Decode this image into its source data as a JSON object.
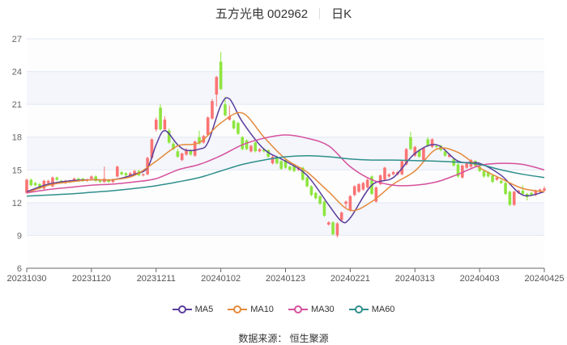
{
  "header": {
    "stock_name": "五方光电 002962",
    "period": "日K"
  },
  "source": "数据来源：  恒生聚源",
  "colors": {
    "up": "#fb7474",
    "down": "#8ee53f",
    "MA5": "#5a3d9c",
    "MA10": "#e48a3a",
    "MA30": "#d6509c",
    "MA60": "#2f8f8c"
  },
  "chart_data": {
    "type": "candlestick",
    "title": "五方光电 002962 日K",
    "ylim": [
      6,
      27
    ],
    "yticks": [
      "6",
      "9",
      "12",
      "15",
      "18",
      "21",
      "24",
      "27"
    ],
    "xticks": [
      {
        "day": 0,
        "label": "20231030"
      },
      {
        "day": 15,
        "label": "20231120"
      },
      {
        "day": 30,
        "label": "20231211"
      },
      {
        "day": 45,
        "label": "20240102"
      },
      {
        "day": 60,
        "label": "20240123"
      },
      {
        "day": 75,
        "label": "20240221"
      },
      {
        "day": 90,
        "label": "20240313"
      },
      {
        "day": 105,
        "label": "20240403"
      },
      {
        "day": 120,
        "label": "20240425"
      }
    ],
    "num_days": 121,
    "candles_ohlc": [
      [
        12.9,
        14.1,
        12.8,
        14.2
      ],
      [
        14.1,
        13.6,
        13.5,
        14.2
      ],
      [
        13.8,
        13.6,
        13.5,
        13.9
      ],
      [
        13.7,
        13.3,
        13.2,
        13.8
      ],
      [
        13.3,
        14.0,
        13.2,
        14.1
      ],
      [
        13.8,
        14.0,
        13.7,
        14.1
      ],
      [
        13.5,
        14.3,
        13.4,
        14.4
      ],
      [
        14.3,
        14.1,
        14.0,
        14.4
      ],
      [
        14.0,
        13.9,
        13.8,
        14.1
      ],
      [
        13.8,
        14.0,
        13.7,
        14.1
      ],
      [
        13.9,
        14.0,
        13.8,
        14.1
      ],
      [
        14.0,
        14.2,
        13.9,
        14.3
      ],
      [
        14.2,
        14.0,
        13.9,
        14.3
      ],
      [
        14.2,
        14.0,
        13.9,
        14.3
      ],
      [
        14.0,
        14.1,
        13.9,
        14.2
      ],
      [
        14.2,
        14.4,
        14.1,
        14.5
      ],
      [
        14.4,
        14.0,
        13.9,
        14.5
      ],
      [
        14.0,
        13.9,
        13.8,
        14.1
      ],
      [
        13.9,
        14.2,
        13.8,
        15.3
      ],
      [
        14.1,
        13.9,
        13.8,
        14.2
      ],
      [
        13.9,
        14.1,
        13.8,
        14.2
      ],
      [
        14.4,
        15.3,
        14.3,
        15.4
      ],
      [
        14.8,
        14.6,
        14.5,
        14.9
      ],
      [
        14.7,
        14.5,
        14.4,
        14.8
      ],
      [
        14.5,
        14.7,
        14.4,
        14.8
      ],
      [
        14.6,
        14.9,
        14.5,
        15.0
      ],
      [
        14.9,
        14.5,
        14.4,
        15.0
      ],
      [
        14.5,
        14.6,
        14.4,
        14.7
      ],
      [
        14.6,
        16.1,
        14.5,
        16.2
      ],
      [
        16.1,
        17.8,
        16.0,
        17.9
      ],
      [
        18.7,
        19.6,
        18.5,
        19.8
      ],
      [
        20.7,
        18.7,
        18.6,
        21.0
      ],
      [
        18.7,
        19.6,
        18.6,
        19.9
      ],
      [
        18.6,
        17.5,
        17.4,
        18.8
      ],
      [
        17.4,
        16.9,
        16.8,
        17.6
      ],
      [
        16.7,
        16.2,
        16.1,
        16.9
      ],
      [
        15.9,
        16.5,
        15.8,
        16.6
      ],
      [
        16.4,
        16.8,
        16.3,
        17.0
      ],
      [
        16.8,
        16.4,
        16.3,
        16.9
      ],
      [
        16.3,
        17.6,
        16.2,
        17.7
      ],
      [
        18.0,
        17.4,
        17.3,
        18.6
      ],
      [
        17.5,
        18.1,
        17.4,
        18.2
      ],
      [
        18.2,
        19.8,
        18.1,
        19.9
      ],
      [
        19.7,
        21.3,
        19.6,
        21.5
      ],
      [
        21.9,
        23.5,
        20.8,
        23.6
      ],
      [
        24.9,
        22.4,
        22.3,
        25.8
      ],
      [
        21.0,
        20.0,
        19.9,
        21.7
      ],
      [
        19.6,
        19.9,
        19.5,
        20.9
      ],
      [
        19.5,
        18.8,
        18.7,
        19.6
      ],
      [
        19.3,
        18.3,
        18.2,
        19.4
      ],
      [
        18.0,
        16.9,
        16.8,
        18.1
      ],
      [
        17.7,
        16.9,
        16.8,
        17.8
      ],
      [
        16.7,
        17.2,
        16.6,
        17.3
      ],
      [
        17.5,
        16.7,
        16.6,
        17.6
      ],
      [
        16.7,
        16.9,
        16.6,
        17.0
      ],
      [
        16.9,
        16.7,
        16.6,
        17.0
      ],
      [
        16.8,
        16.2,
        16.1,
        16.9
      ],
      [
        15.6,
        16.2,
        15.5,
        16.3
      ],
      [
        16.2,
        15.6,
        15.5,
        16.3
      ],
      [
        15.8,
        15.1,
        15.0,
        15.9
      ],
      [
        15.9,
        15.2,
        15.1,
        16.0
      ],
      [
        15.3,
        15.0,
        14.9,
        15.4
      ],
      [
        15.4,
        14.9,
        14.8,
        15.5
      ],
      [
        15.0,
        15.2,
        14.9,
        15.3
      ],
      [
        15.2,
        14.1,
        14.0,
        15.3
      ],
      [
        14.3,
        13.5,
        13.4,
        14.4
      ],
      [
        13.5,
        12.7,
        12.6,
        13.6
      ],
      [
        12.9,
        12.4,
        12.3,
        13.0
      ],
      [
        12.6,
        11.9,
        11.8,
        12.7
      ],
      [
        12.1,
        10.8,
        10.7,
        12.2
      ],
      [
        10.0,
        10.2,
        9.9,
        10.3
      ],
      [
        10.2,
        9.1,
        9.0,
        10.3
      ],
      [
        9.0,
        10.1,
        8.8,
        10.2
      ],
      [
        10.4,
        11.1,
        10.3,
        11.2
      ],
      [
        11.9,
        12.1,
        11.5,
        12.2
      ],
      [
        11.3,
        12.6,
        11.2,
        12.7
      ],
      [
        12.7,
        13.5,
        12.6,
        13.6
      ],
      [
        13.0,
        13.7,
        12.9,
        13.8
      ],
      [
        13.2,
        13.8,
        13.1,
        13.9
      ],
      [
        13.4,
        14.1,
        13.3,
        14.2
      ],
      [
        14.4,
        12.8,
        12.7,
        14.5
      ],
      [
        12.1,
        13.4,
        12.0,
        13.5
      ],
      [
        13.7,
        14.5,
        13.6,
        14.6
      ],
      [
        14.1,
        15.2,
        14.0,
        15.3
      ],
      [
        14.4,
        14.6,
        14.3,
        14.7
      ],
      [
        14.6,
        14.8,
        14.5,
        14.9
      ],
      [
        14.6,
        14.8,
        14.5,
        14.9
      ],
      [
        14.6,
        15.8,
        14.5,
        15.9
      ],
      [
        15.5,
        16.9,
        15.4,
        17.0
      ],
      [
        18.0,
        16.9,
        16.8,
        18.5
      ],
      [
        16.3,
        17.1,
        16.2,
        17.2
      ],
      [
        16.8,
        16.2,
        16.1,
        16.9
      ],
      [
        15.9,
        17.0,
        15.8,
        17.1
      ],
      [
        17.8,
        17.2,
        17.1,
        18.0
      ],
      [
        17.1,
        17.8,
        17.0,
        17.9
      ],
      [
        17.2,
        17.1,
        17.0,
        17.3
      ],
      [
        17.2,
        16.8,
        16.7,
        17.3
      ],
      [
        16.7,
        16.3,
        16.2,
        16.8
      ],
      [
        16.2,
        16.4,
        16.1,
        16.5
      ],
      [
        16.0,
        15.4,
        15.3,
        16.1
      ],
      [
        15.5,
        14.4,
        14.3,
        15.6
      ],
      [
        14.3,
        15.4,
        14.2,
        15.5
      ],
      [
        15.2,
        15.6,
        15.1,
        15.7
      ],
      [
        15.3,
        15.9,
        15.2,
        16.0
      ],
      [
        15.8,
        15.4,
        15.3,
        15.9
      ],
      [
        15.3,
        14.9,
        14.8,
        15.4
      ],
      [
        14.9,
        14.4,
        14.3,
        15.0
      ],
      [
        14.8,
        14.4,
        14.3,
        14.9
      ],
      [
        14.5,
        13.9,
        13.8,
        14.6
      ],
      [
        14.1,
        14.3,
        14.0,
        14.4
      ],
      [
        14.0,
        13.8,
        13.7,
        14.1
      ],
      [
        13.8,
        12.8,
        12.7,
        13.9
      ],
      [
        13.0,
        11.8,
        11.7,
        13.1
      ],
      [
        11.8,
        13.0,
        11.7,
        13.1
      ],
      [
        12.9,
        13.1,
        12.8,
        13.2
      ],
      [
        13.1,
        12.8,
        12.7,
        13.6
      ],
      [
        12.8,
        12.5,
        12.2,
        12.9
      ],
      [
        12.9,
        12.7,
        12.6,
        13.0
      ],
      [
        12.7,
        13.1,
        12.6,
        13.2
      ],
      [
        13.0,
        13.2,
        12.9,
        13.3
      ],
      [
        13.1,
        13.3,
        13.0,
        13.5
      ]
    ],
    "series": [
      {
        "name": "MA5",
        "points": [
          [
            0,
            13.0
          ],
          [
            5,
            13.7
          ],
          [
            10,
            14.0
          ],
          [
            15,
            14.1
          ],
          [
            20,
            14.1
          ],
          [
            25,
            14.6
          ],
          [
            28,
            15.2
          ],
          [
            30,
            17.3
          ],
          [
            32,
            18.6
          ],
          [
            35,
            17.3
          ],
          [
            37,
            16.8
          ],
          [
            40,
            16.9
          ],
          [
            42,
            17.5
          ],
          [
            45,
            20.9
          ],
          [
            47,
            21.5
          ],
          [
            50,
            19.4
          ],
          [
            55,
            16.9
          ],
          [
            60,
            15.8
          ],
          [
            65,
            14.5
          ],
          [
            70,
            11.8
          ],
          [
            73,
            10.3
          ],
          [
            75,
            10.6
          ],
          [
            80,
            13.6
          ],
          [
            85,
            14.3
          ],
          [
            90,
            16.5
          ],
          [
            95,
            17.3
          ],
          [
            100,
            15.8
          ],
          [
            105,
            15.6
          ],
          [
            110,
            14.5
          ],
          [
            115,
            12.7
          ],
          [
            120,
            13.0
          ]
        ]
      },
      {
        "name": "MA10",
        "points": [
          [
            0,
            12.9
          ],
          [
            5,
            13.6
          ],
          [
            10,
            13.9
          ],
          [
            15,
            14.1
          ],
          [
            20,
            14.1
          ],
          [
            25,
            14.5
          ],
          [
            30,
            15.8
          ],
          [
            35,
            17.2
          ],
          [
            40,
            17.5
          ],
          [
            45,
            19.3
          ],
          [
            50,
            20.2
          ],
          [
            55,
            18.0
          ],
          [
            60,
            16.0
          ],
          [
            65,
            14.8
          ],
          [
            70,
            13.0
          ],
          [
            75,
            11.3
          ],
          [
            80,
            12.1
          ],
          [
            85,
            13.7
          ],
          [
            90,
            14.9
          ],
          [
            95,
            16.9
          ],
          [
            100,
            16.6
          ],
          [
            105,
            15.2
          ],
          [
            110,
            14.2
          ],
          [
            115,
            13.3
          ],
          [
            120,
            13.0
          ]
        ]
      },
      {
        "name": "MA30",
        "points": [
          [
            0,
            12.9
          ],
          [
            5,
            13.2
          ],
          [
            10,
            13.4
          ],
          [
            15,
            13.6
          ],
          [
            20,
            13.7
          ],
          [
            25,
            13.9
          ],
          [
            30,
            14.2
          ],
          [
            35,
            15.0
          ],
          [
            40,
            15.5
          ],
          [
            45,
            16.3
          ],
          [
            50,
            17.3
          ],
          [
            55,
            17.9
          ],
          [
            60,
            18.2
          ],
          [
            65,
            17.9
          ],
          [
            70,
            17.2
          ],
          [
            75,
            15.3
          ],
          [
            80,
            14.1
          ],
          [
            85,
            13.6
          ],
          [
            90,
            13.6
          ],
          [
            95,
            13.9
          ],
          [
            100,
            14.6
          ],
          [
            105,
            15.4
          ],
          [
            110,
            15.6
          ],
          [
            115,
            15.5
          ],
          [
            120,
            15.0
          ]
        ]
      },
      {
        "name": "MA60",
        "points": [
          [
            0,
            12.6
          ],
          [
            5,
            12.7
          ],
          [
            10,
            12.8
          ],
          [
            15,
            12.95
          ],
          [
            20,
            13.1
          ],
          [
            25,
            13.3
          ],
          [
            30,
            13.55
          ],
          [
            35,
            13.9
          ],
          [
            40,
            14.3
          ],
          [
            45,
            14.9
          ],
          [
            50,
            15.5
          ],
          [
            55,
            15.9
          ],
          [
            60,
            16.2
          ],
          [
            65,
            16.3
          ],
          [
            70,
            16.2
          ],
          [
            75,
            16.0
          ],
          [
            80,
            15.9
          ],
          [
            85,
            15.9
          ],
          [
            90,
            15.85
          ],
          [
            95,
            15.8
          ],
          [
            100,
            15.7
          ],
          [
            105,
            15.5
          ],
          [
            110,
            15.0
          ],
          [
            115,
            14.6
          ],
          [
            120,
            14.3
          ]
        ]
      }
    ],
    "legend": [
      "MA5",
      "MA10",
      "MA30",
      "MA60"
    ],
    "legend_position": "bottom",
    "grid": true
  }
}
